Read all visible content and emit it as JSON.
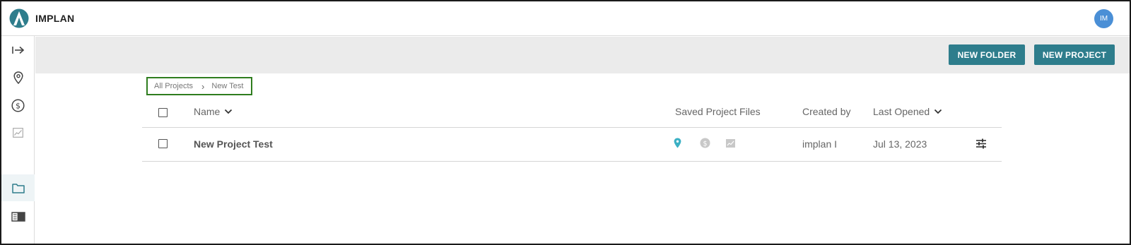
{
  "app": {
    "name": "IMPLAN",
    "avatar_initials": "IM"
  },
  "colors": {
    "accent": "#2e7d8c",
    "avatar": "#4a8fd6",
    "highlight_border": "#2f7d1f",
    "teal_icon": "#3bb0c4"
  },
  "sidebar": {
    "items": [
      {
        "icon": "expand-arrow-icon"
      },
      {
        "icon": "location-pin-icon"
      },
      {
        "icon": "dollar-circle-icon"
      },
      {
        "icon": "chart-icon"
      },
      {
        "icon": "folder-icon",
        "active": true
      },
      {
        "icon": "book-icon"
      }
    ]
  },
  "toolbar": {
    "new_folder_label": "NEW FOLDER",
    "new_project_label": "NEW PROJECT"
  },
  "breadcrumb": {
    "root": "All Projects",
    "current": "New Test"
  },
  "table": {
    "headers": {
      "name": "Name",
      "saved_files": "Saved Project Files",
      "created_by": "Created by",
      "last_opened": "Last Opened"
    },
    "rows": [
      {
        "name": "New Project Test",
        "created_by": "implan I",
        "last_opened": "Jul 13, 2023",
        "file_icons": [
          "location-pin-icon",
          "dollar-circle-icon",
          "chart-icon"
        ]
      }
    ]
  }
}
